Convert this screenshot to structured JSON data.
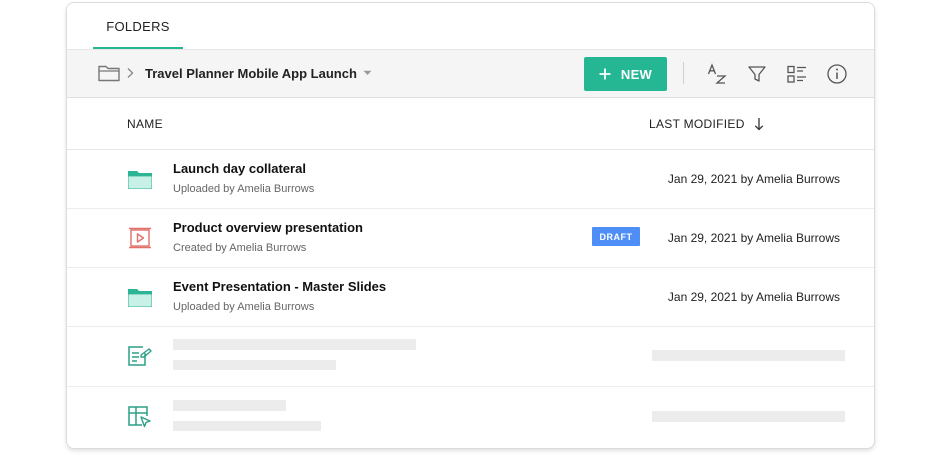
{
  "tabs": [
    {
      "label": "FOLDERS"
    }
  ],
  "toolbar": {
    "breadcrumb_title": "Travel Planner Mobile App Launch",
    "new_label": "NEW"
  },
  "columns": {
    "name": "NAME",
    "last_modified": "LAST MODIFIED"
  },
  "rows": [
    {
      "title": "Launch day collateral",
      "subtitle": "Uploaded by Amelia Burrows",
      "modified": "Jan 29, 2021 by Amelia Burrows",
      "icon": "folder-icon"
    },
    {
      "title": "Product overview presentation",
      "subtitle": "Created by Amelia Burrows",
      "modified": "Jan 29, 2021 by Amelia Burrows",
      "icon": "presentation-icon",
      "badge": "DRAFT"
    },
    {
      "title": "Event Presentation - Master Slides",
      "subtitle": "Uploaded by Amelia Burrows",
      "modified": "Jan 29, 2021 by Amelia Burrows",
      "icon": "folder-icon"
    }
  ],
  "placeholder_rows": [
    {
      "icon": "document-edit-icon"
    },
    {
      "icon": "spreadsheet-icon"
    }
  ],
  "colors": {
    "accent": "#25b794",
    "badge": "#4f8ef7",
    "presentation": "#e0706a",
    "toolbar_bg": "#f5f5f5"
  },
  "icons": [
    "folder-icon",
    "chevron-right-icon",
    "caret-down-icon",
    "plus-icon",
    "sort-az-icon",
    "filter-icon",
    "view-list-icon",
    "info-icon",
    "arrow-down-icon",
    "presentation-icon",
    "document-edit-icon",
    "spreadsheet-icon"
  ]
}
